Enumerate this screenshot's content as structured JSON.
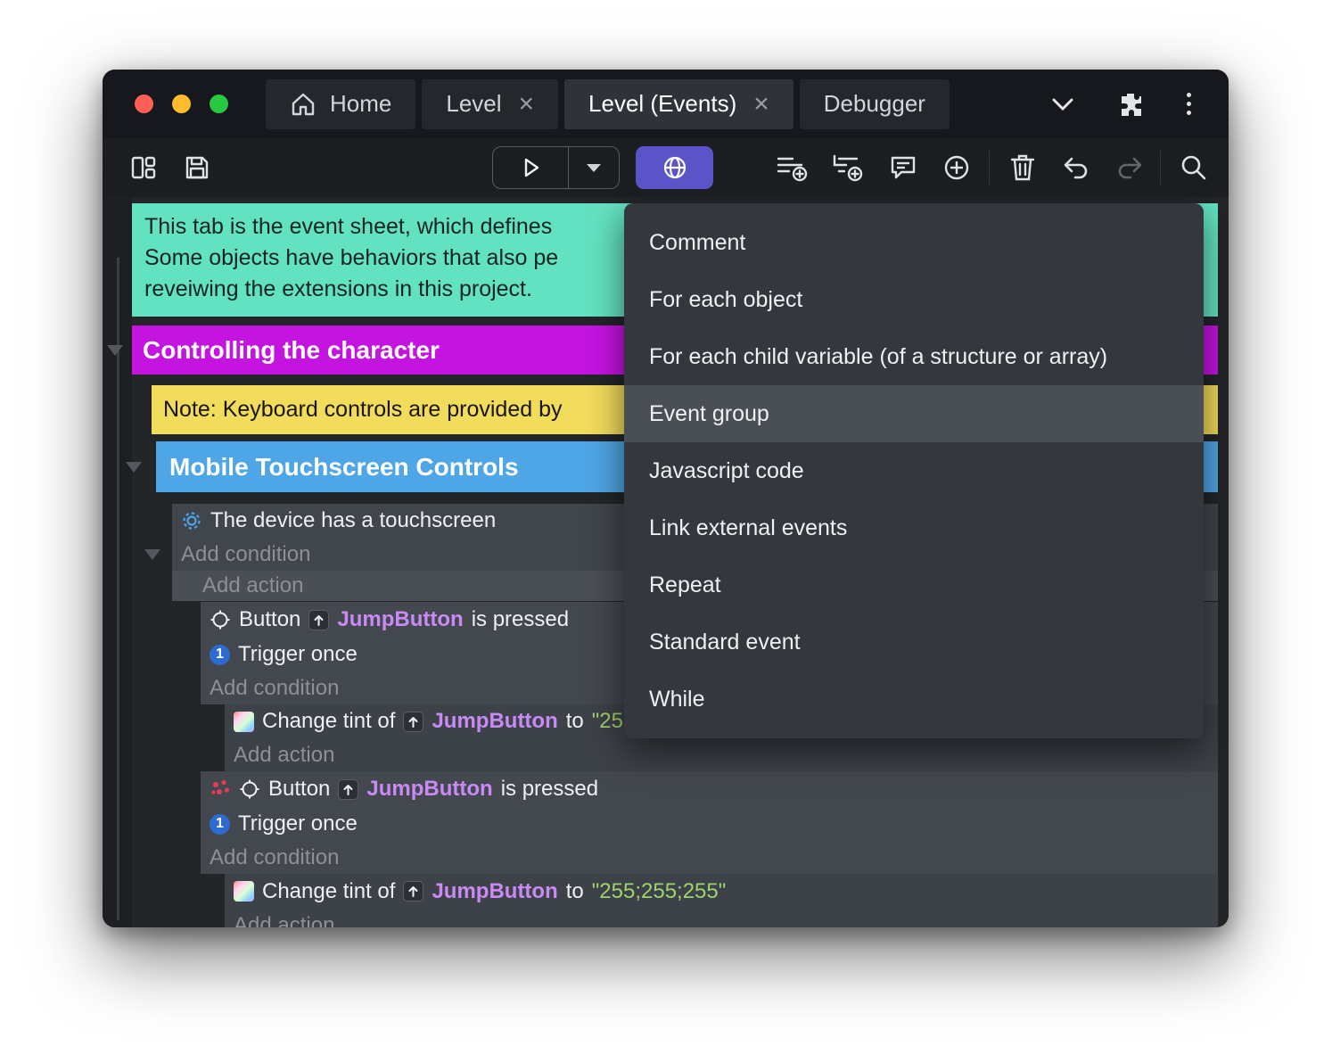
{
  "titlebar": {
    "tabs": [
      {
        "label": "Home"
      },
      {
        "label": "Level",
        "close": "×"
      },
      {
        "label": "Level (Events)",
        "close": "×"
      },
      {
        "label": "Debugger"
      }
    ]
  },
  "menu": {
    "items": [
      "Comment",
      "For each object",
      "For each child variable (of a structure or array)",
      "Event group",
      "Javascript code",
      "Link external events",
      "Repeat",
      "Standard event",
      "While"
    ],
    "highlighted": "Event group"
  },
  "sheet": {
    "comment": {
      "line1": "This tab is the event sheet, which defines",
      "line2": "Some objects have behaviors that also pe",
      "line3": "reveiwing the extensions in this project."
    },
    "group_character": "Controlling the character",
    "note": "Note: Keyboard controls are provided by",
    "group_touch": "Mobile Touchscreen Controls",
    "touch_condition": "The device has a touchscreen",
    "add_condition": "Add condition",
    "add_action": "Add action",
    "event_button": {
      "pre": "Button",
      "object": "JumpButton",
      "post": "is pressed"
    },
    "trigger_once": "Trigger once",
    "trigger_glyph": "1",
    "action_tint": {
      "pre": "Change tint of",
      "object": "JumpButton",
      "post": "to",
      "value": "\"255;255;255\""
    }
  },
  "colors": {
    "comment_teal": "#63e2c1",
    "group_magenta": "#c414e0",
    "note_yellow": "#f2dc5c",
    "group_blue": "#4fa6e6",
    "accent_purple": "#5b54c9",
    "object_purple": "#c98af5",
    "string_green": "#9fd36d"
  }
}
